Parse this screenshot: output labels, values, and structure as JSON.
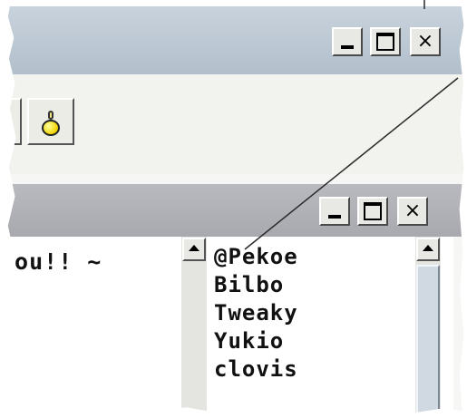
{
  "window_top": {
    "caption_buttons": {
      "minimize": "_",
      "maximize": "□",
      "close": "×"
    },
    "toolbar": {
      "buttons": [
        {
          "icon": "partial-icon"
        },
        {
          "icon": "light-bulb-icon"
        }
      ]
    }
  },
  "chat_window": {
    "caption_buttons": {
      "minimize": "_",
      "maximize": "□",
      "close": "×"
    },
    "message_text": "You!! ~",
    "users": [
      "@Pekoe",
      "Bilbo",
      "Tweaky",
      "Yukio",
      "clovis"
    ]
  },
  "colors": {
    "title_active": "#b8c5d1",
    "title_inactive": "#acadb3",
    "content_bg": "#ffffff",
    "scroll_thumb": "#d0d8e2"
  }
}
